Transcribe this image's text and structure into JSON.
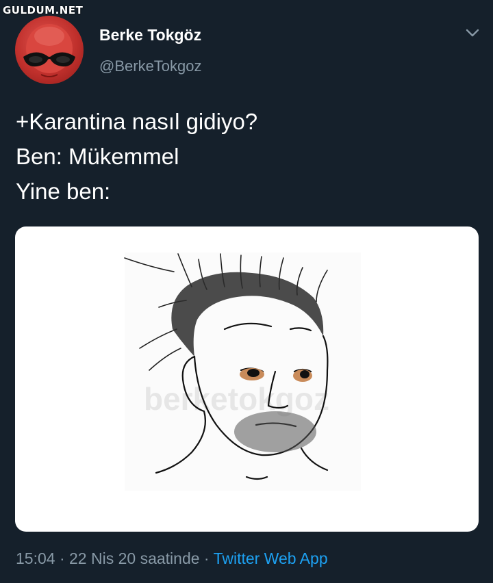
{
  "site_watermark": "GULDUM.NET",
  "user": {
    "display_name": "Berke Tokgöz",
    "handle": "@BerkeTokgoz"
  },
  "tweet": {
    "lines": [
      "+Karantina nasıl gidiyo?",
      "Ben: Mükemmel",
      "Yine ben:"
    ]
  },
  "media": {
    "watermark": "berketokgoz"
  },
  "meta": {
    "time": "15:04",
    "separator1": " · ",
    "date": "22 Nis 20 saatinde",
    "separator2": " · ",
    "source": "Twitter Web App"
  },
  "icons": {
    "chevron": "chevron-down-icon"
  },
  "colors": {
    "background": "#15202b",
    "secondary_text": "#8899a6",
    "link": "#1da1f2"
  }
}
